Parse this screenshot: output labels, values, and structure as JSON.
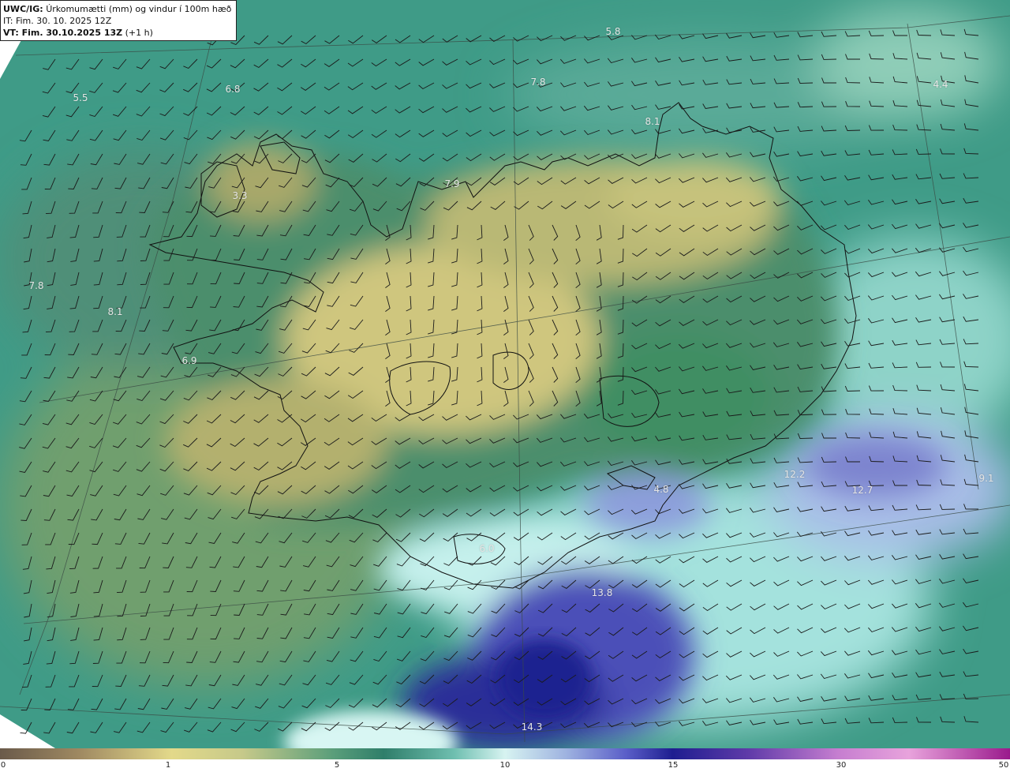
{
  "header": {
    "product": "UWC/IG:",
    "title": "Úrkomumætti (mm) og vindur í 100m hæð",
    "init_time": "IT: Fim. 30. 10. 2025 12Z",
    "valid_prefix": "VT: Fim. 30.10.2025 13Z",
    "valid_suffix": "(+1 h)"
  },
  "map_values": [
    "5.8",
    "6.8",
    "5.5",
    "7.8",
    "4.4",
    "7.8",
    "8.1",
    "8.1",
    "3.3",
    "7.9",
    "6.9",
    "12.2",
    "12.7",
    "9.1",
    "4.8",
    "6.0",
    "13.8",
    "14.3"
  ],
  "colorbar": {
    "ticks": [
      "0",
      "1",
      "5",
      "10",
      "15",
      "30",
      "50"
    ]
  },
  "colors": {
    "sea_teal": "#3f9b87",
    "highland_yellow": "#d8cf86",
    "lowland_green": "#5f9c74",
    "heavy_blue": "#3b3ea8",
    "light_cyan": "#bfeeea"
  }
}
